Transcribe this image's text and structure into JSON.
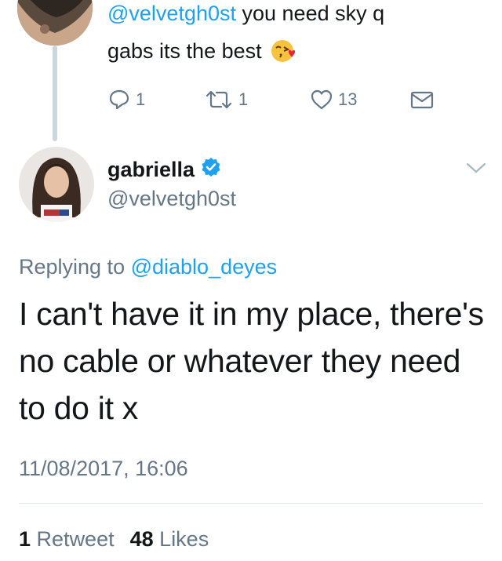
{
  "reply_tweet": {
    "mention": "@velvetgh0st",
    "text_line1": " you need sky q",
    "text_line2": "gabs its the best",
    "emoji": "kissing-heart-emoji",
    "actions": {
      "reply_count": "1",
      "retweet_count": "1",
      "like_count": "13"
    }
  },
  "tweet": {
    "author_name": "gabriella",
    "verified": true,
    "handle": "@velvetgh0st",
    "replying_prefix": "Replying to ",
    "replying_mention": "@diablo_deyes",
    "body": "I can't have it in my place, there's no cable or whatever they need to do it x",
    "timestamp": "11/08/2017, 16:06",
    "retweets_count": "1",
    "retweets_label": "Retweet",
    "likes_count": "48",
    "likes_label": "Likes"
  },
  "colors": {
    "accent": "#1da1f2",
    "secondary_text": "#657786",
    "primary_text": "#14171a",
    "thread_line": "#ccd6dd"
  }
}
